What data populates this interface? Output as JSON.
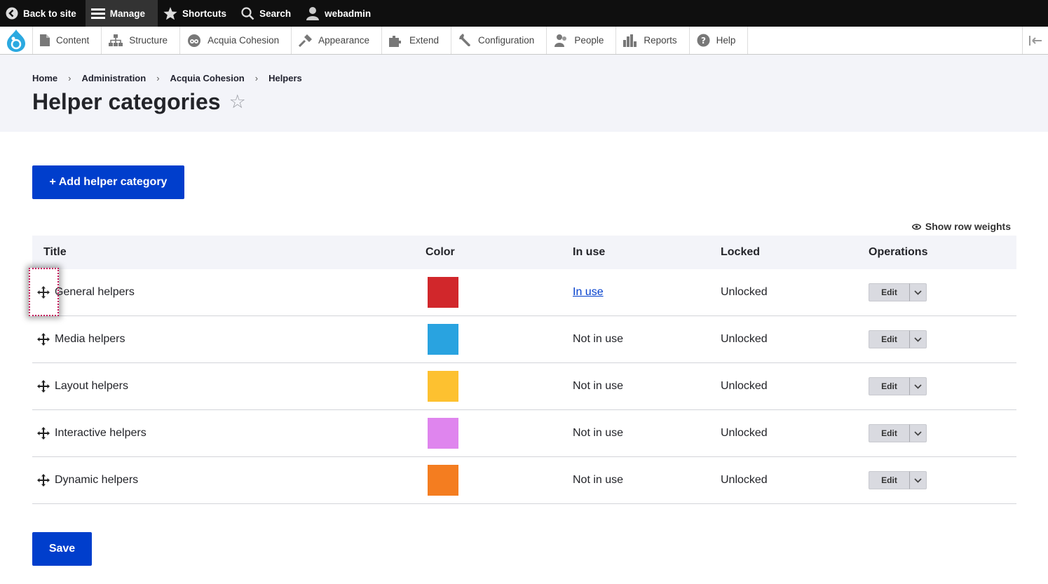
{
  "toolbar": {
    "back_to_site": "Back to site",
    "manage": "Manage",
    "shortcuts": "Shortcuts",
    "search": "Search",
    "user": "webadmin"
  },
  "tray": {
    "items": [
      {
        "label": "Content",
        "icon": "content-icon"
      },
      {
        "label": "Structure",
        "icon": "structure-icon"
      },
      {
        "label": "Acquia Cohesion",
        "icon": "cohesion-icon"
      },
      {
        "label": "Appearance",
        "icon": "appearance-icon"
      },
      {
        "label": "Extend",
        "icon": "extend-icon"
      },
      {
        "label": "Configuration",
        "icon": "configuration-icon"
      },
      {
        "label": "People",
        "icon": "people-icon"
      },
      {
        "label": "Reports",
        "icon": "reports-icon"
      },
      {
        "label": "Help",
        "icon": "help-icon"
      }
    ]
  },
  "breadcrumb": [
    "Home",
    "Administration",
    "Acquia Cohesion",
    "Helpers"
  ],
  "page": {
    "title": "Helper categories",
    "add_button": "+ Add helper category",
    "show_row_weights": "Show row weights",
    "save_button": "Save"
  },
  "table": {
    "headers": {
      "title": "Title",
      "color": "Color",
      "in_use": "In use",
      "locked": "Locked",
      "operations": "Operations"
    },
    "rows": [
      {
        "title": "General helpers",
        "color": "#d1272b",
        "in_use": "In use",
        "in_use_link": true,
        "locked": "Unlocked",
        "edit": "Edit"
      },
      {
        "title": "Media helpers",
        "color": "#29a3e0",
        "in_use": "Not in use",
        "in_use_link": false,
        "locked": "Unlocked",
        "edit": "Edit"
      },
      {
        "title": "Layout helpers",
        "color": "#fdc130",
        "in_use": "Not in use",
        "in_use_link": false,
        "locked": "Unlocked",
        "edit": "Edit"
      },
      {
        "title": "Interactive helpers",
        "color": "#df85ee",
        "in_use": "Not in use",
        "in_use_link": false,
        "locked": "Unlocked",
        "edit": "Edit"
      },
      {
        "title": "Dynamic helpers",
        "color": "#f47d20",
        "in_use": "Not in use",
        "in_use_link": false,
        "locked": "Unlocked",
        "edit": "Edit"
      }
    ]
  },
  "colors": {
    "accent": "#003ecc",
    "toolbar_bg": "#0f0f0f",
    "header_bg": "#f3f4f9",
    "focus": "#c4145a"
  }
}
